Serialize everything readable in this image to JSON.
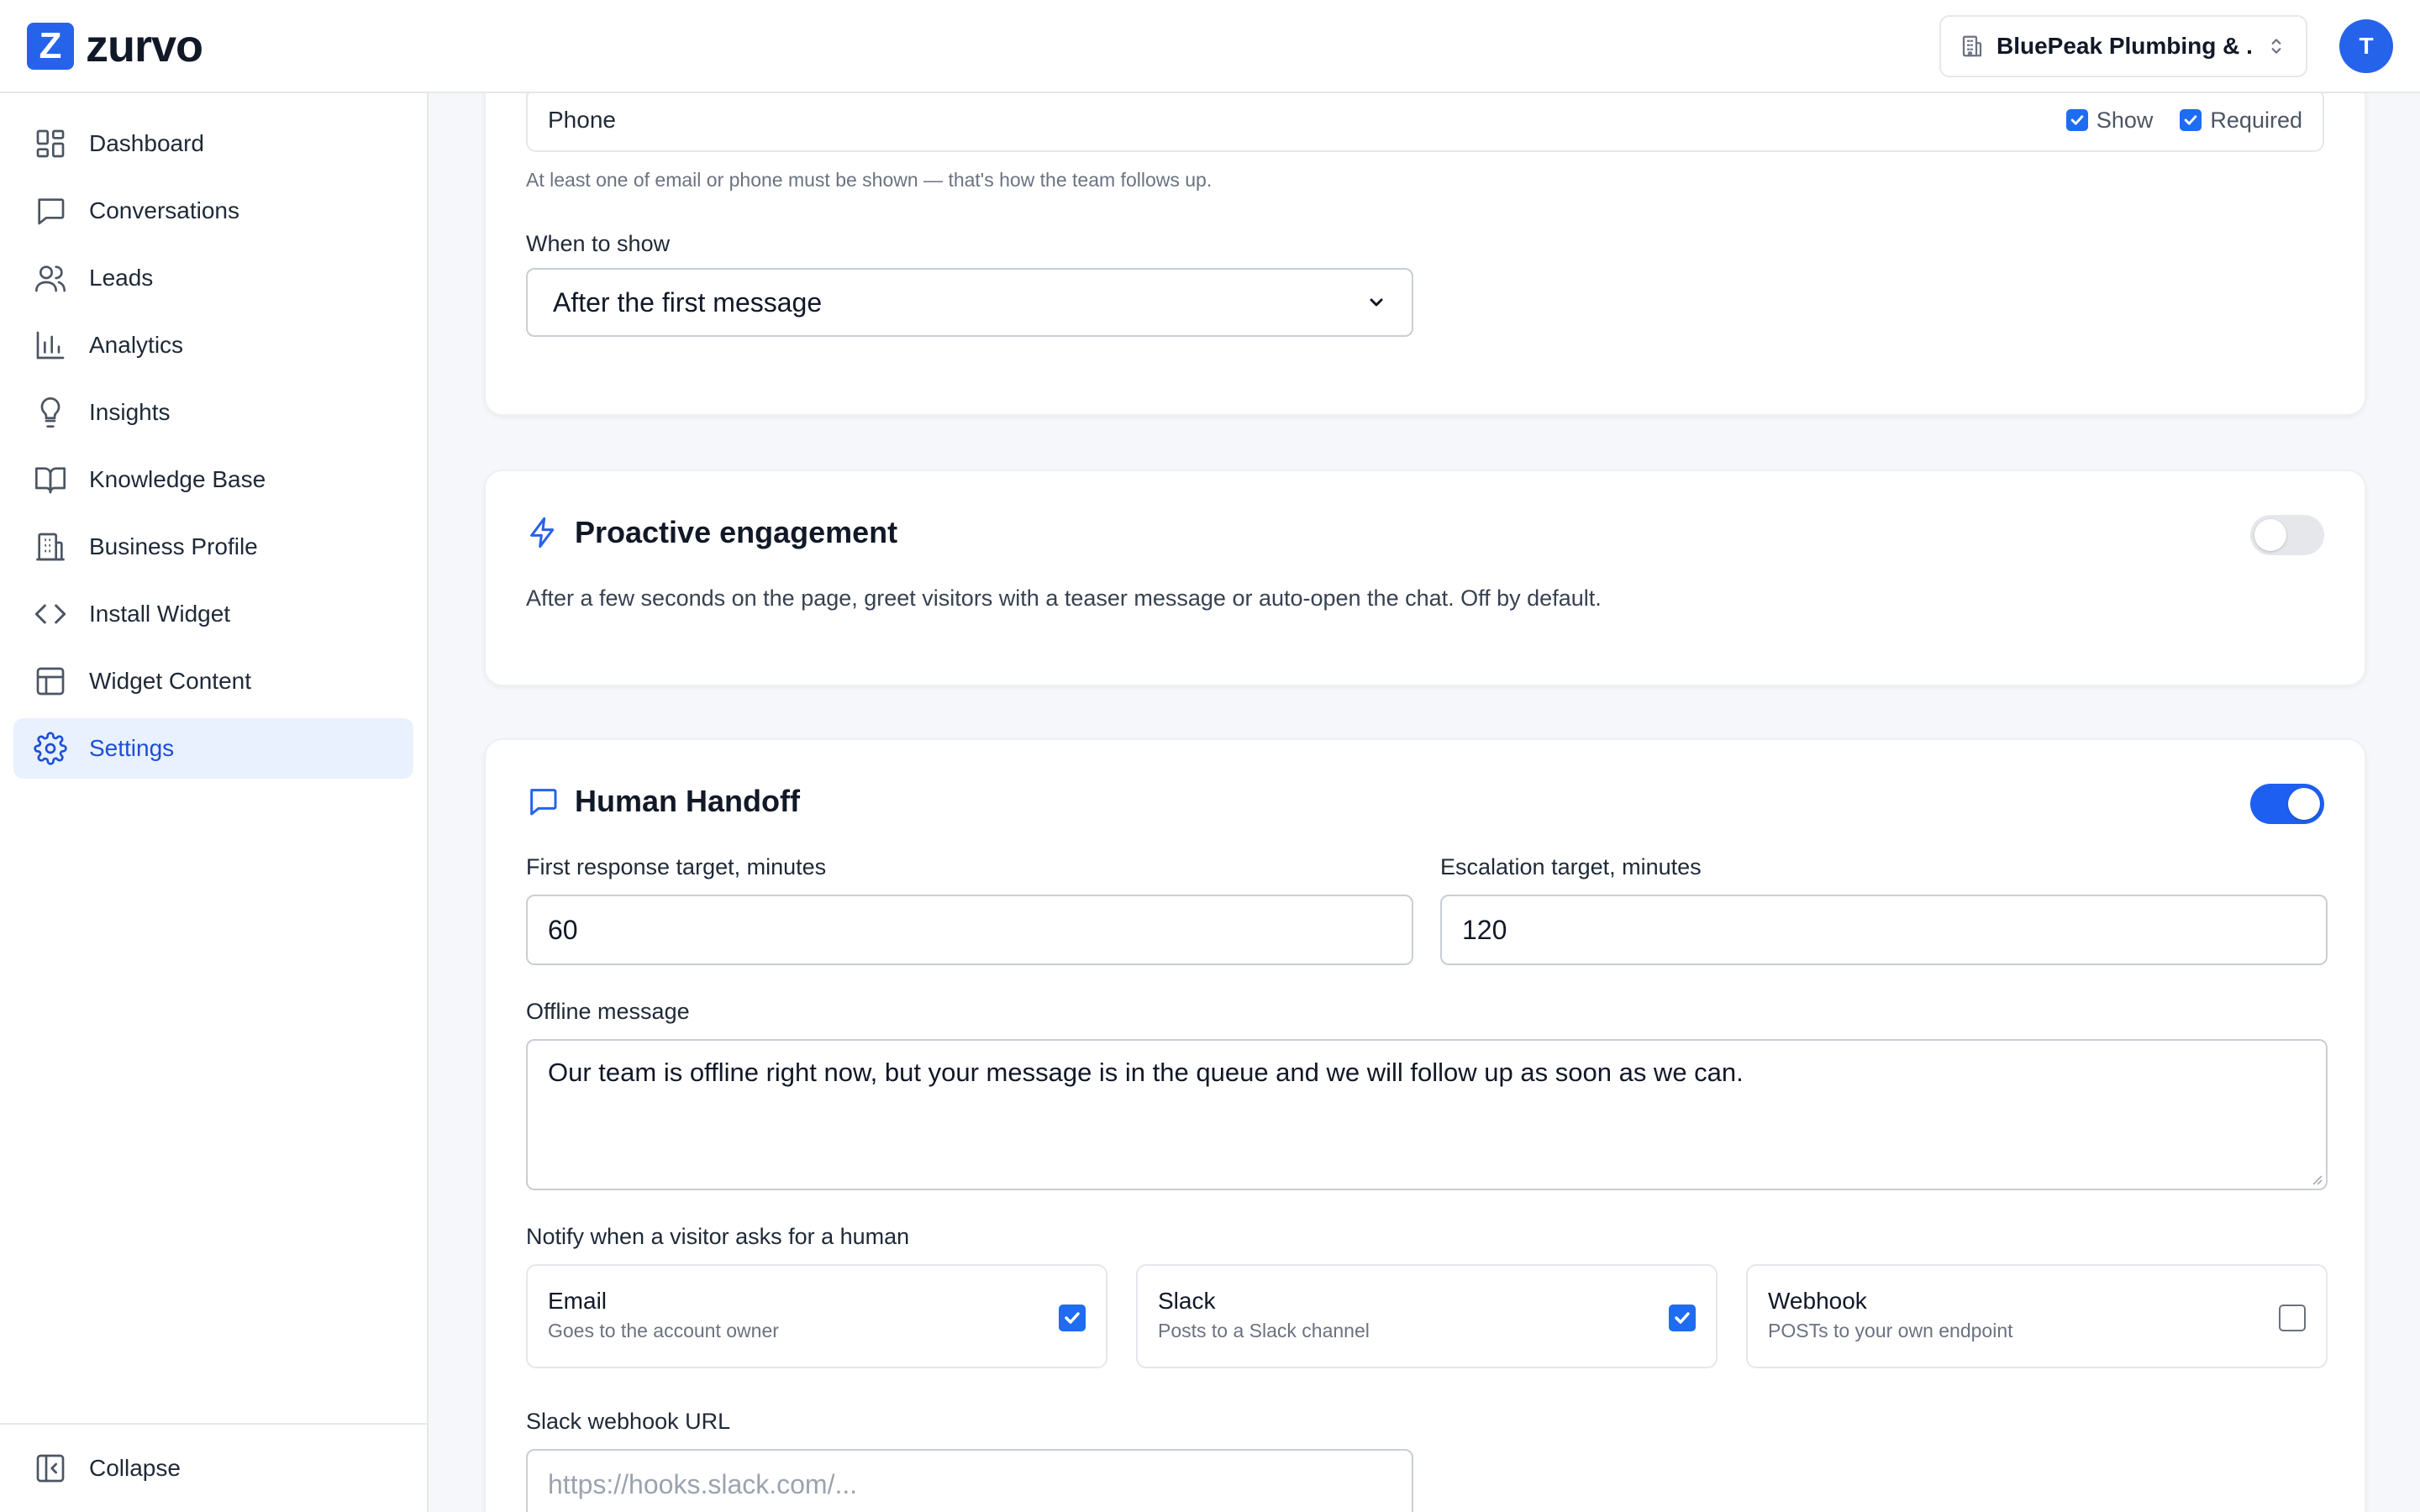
{
  "brand": {
    "logo_letter": "Z",
    "name": "zurvo"
  },
  "header": {
    "business_name": "BluePeak Plumbing & ...",
    "avatar_initial": "T"
  },
  "sidebar": {
    "items": [
      {
        "label": "Dashboard",
        "icon": "dashboard-icon"
      },
      {
        "label": "Conversations",
        "icon": "chat-bubble-icon"
      },
      {
        "label": "Leads",
        "icon": "users-icon"
      },
      {
        "label": "Analytics",
        "icon": "bar-chart-icon"
      },
      {
        "label": "Insights",
        "icon": "lightbulb-icon"
      },
      {
        "label": "Knowledge Base",
        "icon": "book-open-icon"
      },
      {
        "label": "Business Profile",
        "icon": "building-icon"
      },
      {
        "label": "Install Widget",
        "icon": "code-icon"
      },
      {
        "label": "Widget Content",
        "icon": "layout-icon"
      },
      {
        "label": "Settings",
        "icon": "gear-icon",
        "active": true
      }
    ],
    "collapse_label": "Collapse"
  },
  "contact_fields": {
    "phone": {
      "label": "Phone",
      "show_label": "Show",
      "show": true,
      "required_label": "Required",
      "required": true
    },
    "hint": "At least one of email or phone must be shown — that's how the team follows up.",
    "when_label": "When to show",
    "when_value": "After the first message"
  },
  "proactive": {
    "title": "Proactive engagement",
    "enabled": false,
    "description": "After a few seconds on the page, greet visitors with a teaser message or auto-open the chat. Off by default."
  },
  "handoff": {
    "title": "Human Handoff",
    "enabled": true,
    "first_response_label": "First response target, minutes",
    "first_response_value": "60",
    "escalation_label": "Escalation target, minutes",
    "escalation_value": "120",
    "offline_label": "Offline message",
    "offline_value": "Our team is offline right now, but your message is in the queue and we will follow up as soon as we can.",
    "notify_label": "Notify when a visitor asks for a human",
    "channels": [
      {
        "title": "Email",
        "subtitle": "Goes to the account owner",
        "checked": true
      },
      {
        "title": "Slack",
        "subtitle": "Posts to a Slack channel",
        "checked": true
      },
      {
        "title": "Webhook",
        "subtitle": "POSTs to your own endpoint",
        "checked": false
      }
    ],
    "slack_url_label": "Slack webhook URL",
    "slack_url_placeholder": "https://hooks.slack.com/..."
  },
  "colors": {
    "accent": "#2563eb",
    "active_bg": "#e8f1fd",
    "toggle_on": "#1d5ff0",
    "toggle_off": "#e5e7eb"
  }
}
